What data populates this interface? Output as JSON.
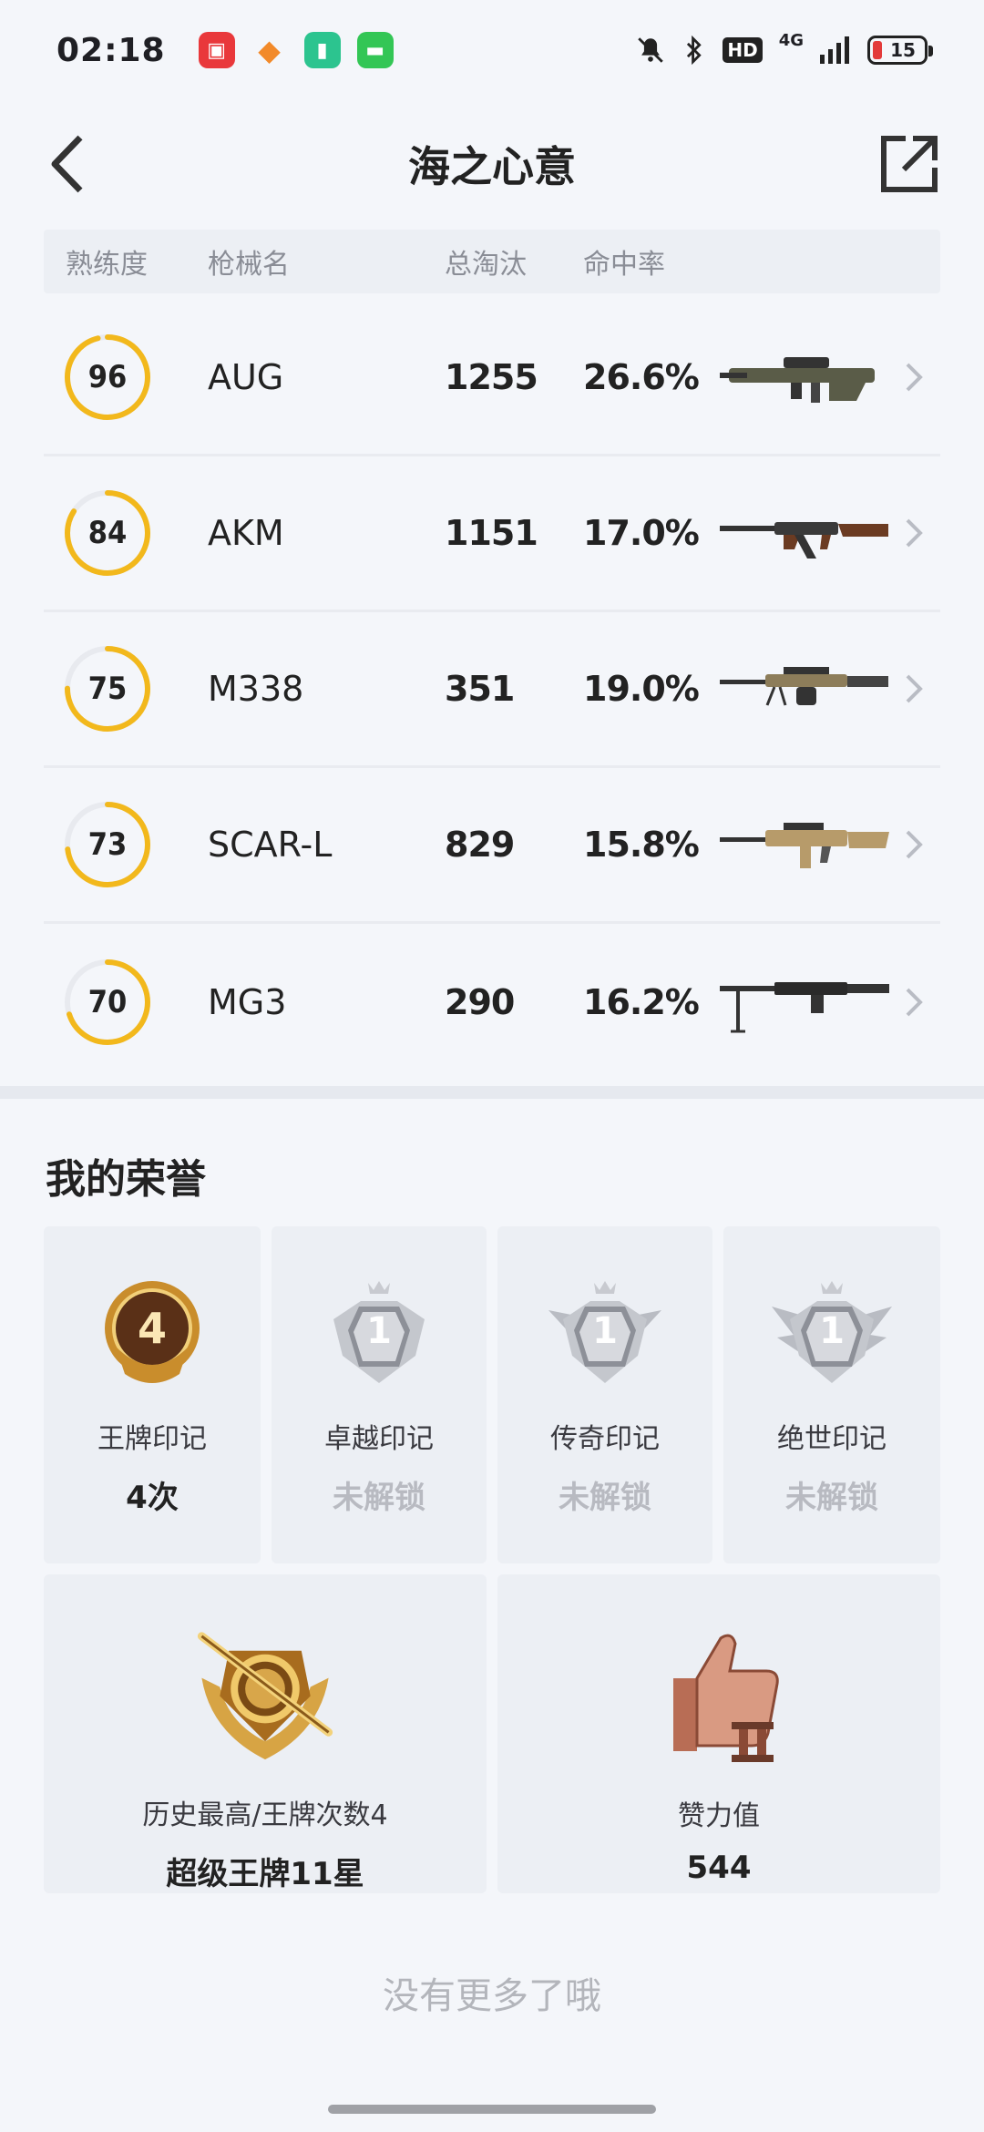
{
  "status_bar": {
    "time": "02:18",
    "hd": "HD",
    "network": "4G",
    "battery": "15"
  },
  "header": {
    "title": "海之心意"
  },
  "table": {
    "headers": {
      "proficiency": "熟练度",
      "gun_name": "枪械名",
      "kills": "总淘汰",
      "accuracy": "命中率"
    },
    "rows": [
      {
        "proficiency": "96",
        "progress": 0.96,
        "name": "AUG",
        "kills": "1255",
        "accuracy": "26.6%",
        "gun_icon": "aug-rifle-icon"
      },
      {
        "proficiency": "84",
        "progress": 0.84,
        "name": "AKM",
        "kills": "1151",
        "accuracy": "17.0%",
        "gun_icon": "akm-rifle-icon"
      },
      {
        "proficiency": "75",
        "progress": 0.75,
        "name": "M338",
        "kills": "351",
        "accuracy": "19.0%",
        "gun_icon": "m338-rifle-icon"
      },
      {
        "proficiency": "73",
        "progress": 0.73,
        "name": "SCAR-L",
        "kills": "829",
        "accuracy": "15.8%",
        "gun_icon": "scarl-rifle-icon"
      },
      {
        "proficiency": "70",
        "progress": 0.7,
        "name": "MG3",
        "kills": "290",
        "accuracy": "16.2%",
        "gun_icon": "mg3-gun-icon"
      }
    ]
  },
  "honors": {
    "title": "我的荣誉",
    "marks": [
      {
        "label": "王牌印记",
        "value": "4次",
        "locked": false,
        "badge_number": "4"
      },
      {
        "label": "卓越印记",
        "value": "未解锁",
        "locked": true,
        "badge_number": "1"
      },
      {
        "label": "传奇印记",
        "value": "未解锁",
        "locked": true,
        "badge_number": "1"
      },
      {
        "label": "绝世印记",
        "value": "未解锁",
        "locked": true,
        "badge_number": "1"
      }
    ],
    "best": {
      "label": "历史最高/王牌次数4",
      "value": "超级王牌11星"
    },
    "likes": {
      "label": "赞力值",
      "value": "544"
    }
  },
  "footer": {
    "no_more": "没有更多了哦"
  },
  "colors": {
    "ring_accent": "#f2b81c",
    "ring_track": "#e8eaef",
    "background": "#f4f6fa"
  }
}
